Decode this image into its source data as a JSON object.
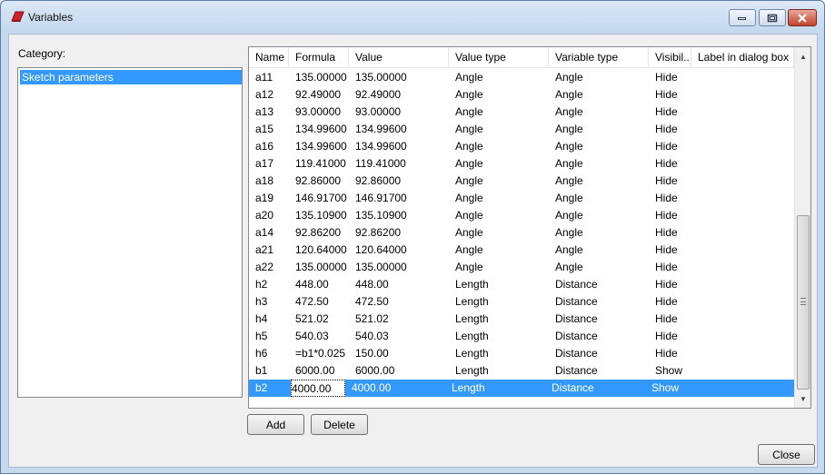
{
  "window": {
    "title": "Variables",
    "controls": {
      "minimize": "minimize",
      "maximize": "maximize",
      "close": "close"
    }
  },
  "category": {
    "label": "Category:",
    "items": [
      "Sketch parameters"
    ]
  },
  "table": {
    "columns": [
      "Name",
      "Formula",
      "Value",
      "Value type",
      "Variable type",
      "Visibil...",
      "Label in dialog box"
    ],
    "rows": [
      [
        "a11",
        "135.00000",
        "135.00000",
        "Angle",
        "Angle",
        "Hide",
        ""
      ],
      [
        "a12",
        "92.49000",
        "92.49000",
        "Angle",
        "Angle",
        "Hide",
        ""
      ],
      [
        "a13",
        "93.00000",
        "93.00000",
        "Angle",
        "Angle",
        "Hide",
        ""
      ],
      [
        "a15",
        "134.99600",
        "134.99600",
        "Angle",
        "Angle",
        "Hide",
        ""
      ],
      [
        "a16",
        "134.99600",
        "134.99600",
        "Angle",
        "Angle",
        "Hide",
        ""
      ],
      [
        "a17",
        "119.41000",
        "119.41000",
        "Angle",
        "Angle",
        "Hide",
        ""
      ],
      [
        "a18",
        "92.86000",
        "92.86000",
        "Angle",
        "Angle",
        "Hide",
        ""
      ],
      [
        "a19",
        "146.91700",
        "146.91700",
        "Angle",
        "Angle",
        "Hide",
        ""
      ],
      [
        "a20",
        "135.10900",
        "135.10900",
        "Angle",
        "Angle",
        "Hide",
        ""
      ],
      [
        "a14",
        "92.86200",
        "92.86200",
        "Angle",
        "Angle",
        "Hide",
        ""
      ],
      [
        "a21",
        "120.64000",
        "120.64000",
        "Angle",
        "Angle",
        "Hide",
        ""
      ],
      [
        "a22",
        "135.00000",
        "135.00000",
        "Angle",
        "Angle",
        "Hide",
        ""
      ],
      [
        "h2",
        "448.00",
        "448.00",
        "Length",
        "Distance",
        "Hide",
        ""
      ],
      [
        "h3",
        "472.50",
        "472.50",
        "Length",
        "Distance",
        "Hide",
        ""
      ],
      [
        "h4",
        "521.02",
        "521.02",
        "Length",
        "Distance",
        "Hide",
        ""
      ],
      [
        "h5",
        "540.03",
        "540.03",
        "Length",
        "Distance",
        "Hide",
        ""
      ],
      [
        "h6",
        "=b1*0.025",
        "150.00",
        "Length",
        "Distance",
        "Hide",
        ""
      ],
      [
        "b1",
        "6000.00",
        "6000.00",
        "Length",
        "Distance",
        "Show",
        ""
      ],
      [
        "b2",
        "4000.00",
        "4000.00",
        "Length",
        "Distance",
        "Show",
        ""
      ]
    ],
    "selected_row": 18
  },
  "buttons": {
    "add": "Add",
    "delete": "Delete",
    "close": "Close"
  },
  "colors": {
    "selection": "#3399ff",
    "title_bar": "#c4d8ee"
  }
}
